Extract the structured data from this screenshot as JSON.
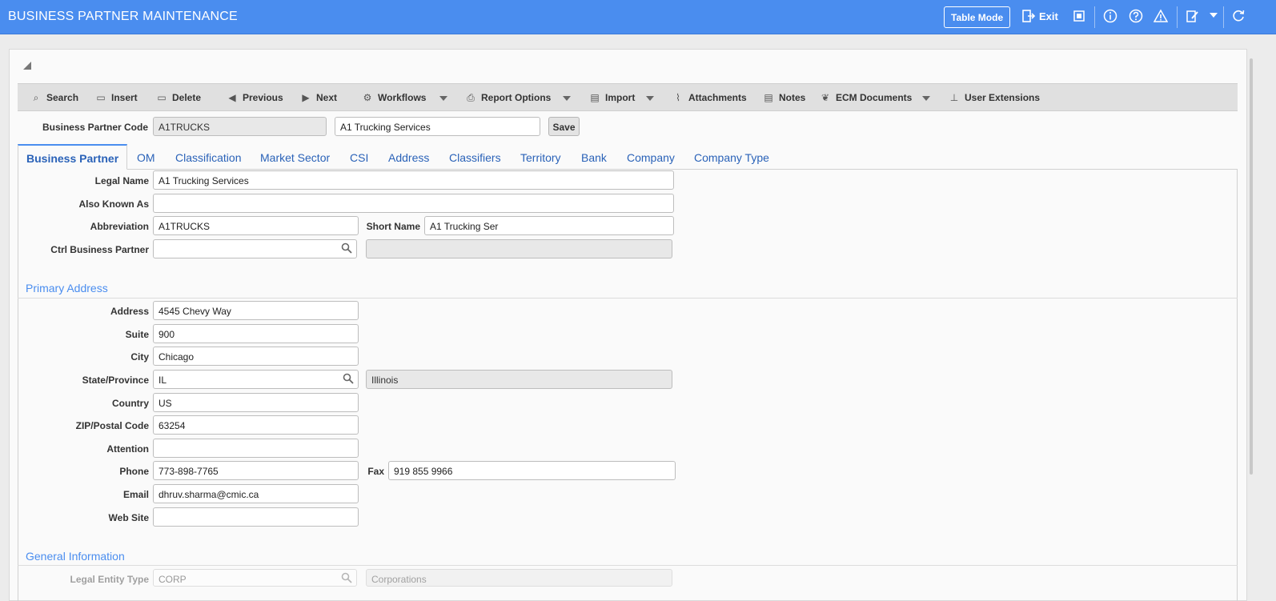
{
  "header": {
    "title": "BUSINESS PARTNER MAINTENANCE",
    "table_mode_label": "Table Mode",
    "exit_label": "Exit"
  },
  "toolbar": {
    "search": "Search",
    "insert": "Insert",
    "delete": "Delete",
    "previous": "Previous",
    "next": "Next",
    "workflows": "Workflows",
    "report_options": "Report Options",
    "import": "Import",
    "attachments": "Attachments",
    "notes": "Notes",
    "ecm_documents": "ECM Documents",
    "user_extensions": "User Extensions"
  },
  "record": {
    "code_label": "Business Partner Code",
    "code_value": "A1TRUCKS",
    "name_value": "A1 Trucking Services",
    "save_label": "Save"
  },
  "tabs": [
    "Business Partner",
    "OM",
    "Classification",
    "Market Sector",
    "CSI",
    "Address",
    "Classifiers",
    "Territory",
    "Bank",
    "Company",
    "Company Type"
  ],
  "general": {
    "legal_name_label": "Legal Name",
    "legal_name_value": "A1 Trucking Services",
    "aka_label": "Also Known As",
    "aka_value": "",
    "abbrev_label": "Abbreviation",
    "abbrev_value": "A1TRUCKS",
    "short_name_label": "Short Name",
    "short_name_value": "A1 Trucking Ser",
    "ctrl_bp_label": "Ctrl Business Partner",
    "ctrl_bp_value": "",
    "ctrl_bp_desc": ""
  },
  "primary_address": {
    "title": "Primary Address",
    "address_label": "Address",
    "address_value": "4545 Chevy Way",
    "suite_label": "Suite",
    "suite_value": "900",
    "city_label": "City",
    "city_value": "Chicago",
    "state_label": "State/Province",
    "state_value": "IL",
    "state_desc": "Illinois",
    "country_label": "Country",
    "country_value": "US",
    "zip_label": "ZIP/Postal Code",
    "zip_value": "63254",
    "attention_label": "Attention",
    "attention_value": "",
    "phone_label": "Phone",
    "phone_value": "773-898-7765",
    "fax_label": "Fax",
    "fax_value": "919 855 9966",
    "email_label": "Email",
    "email_value": "dhruv.sharma@cmic.ca",
    "website_label": "Web Site",
    "website_value": ""
  },
  "general_information": {
    "title": "General Information",
    "legal_entity_label": "Legal Entity Type",
    "legal_entity_value": "CORP",
    "legal_entity_desc": "Corporations"
  },
  "colors": {
    "header_bg": "#4a8def",
    "tab_text": "#2a62b8",
    "section_title": "#4a8def"
  }
}
